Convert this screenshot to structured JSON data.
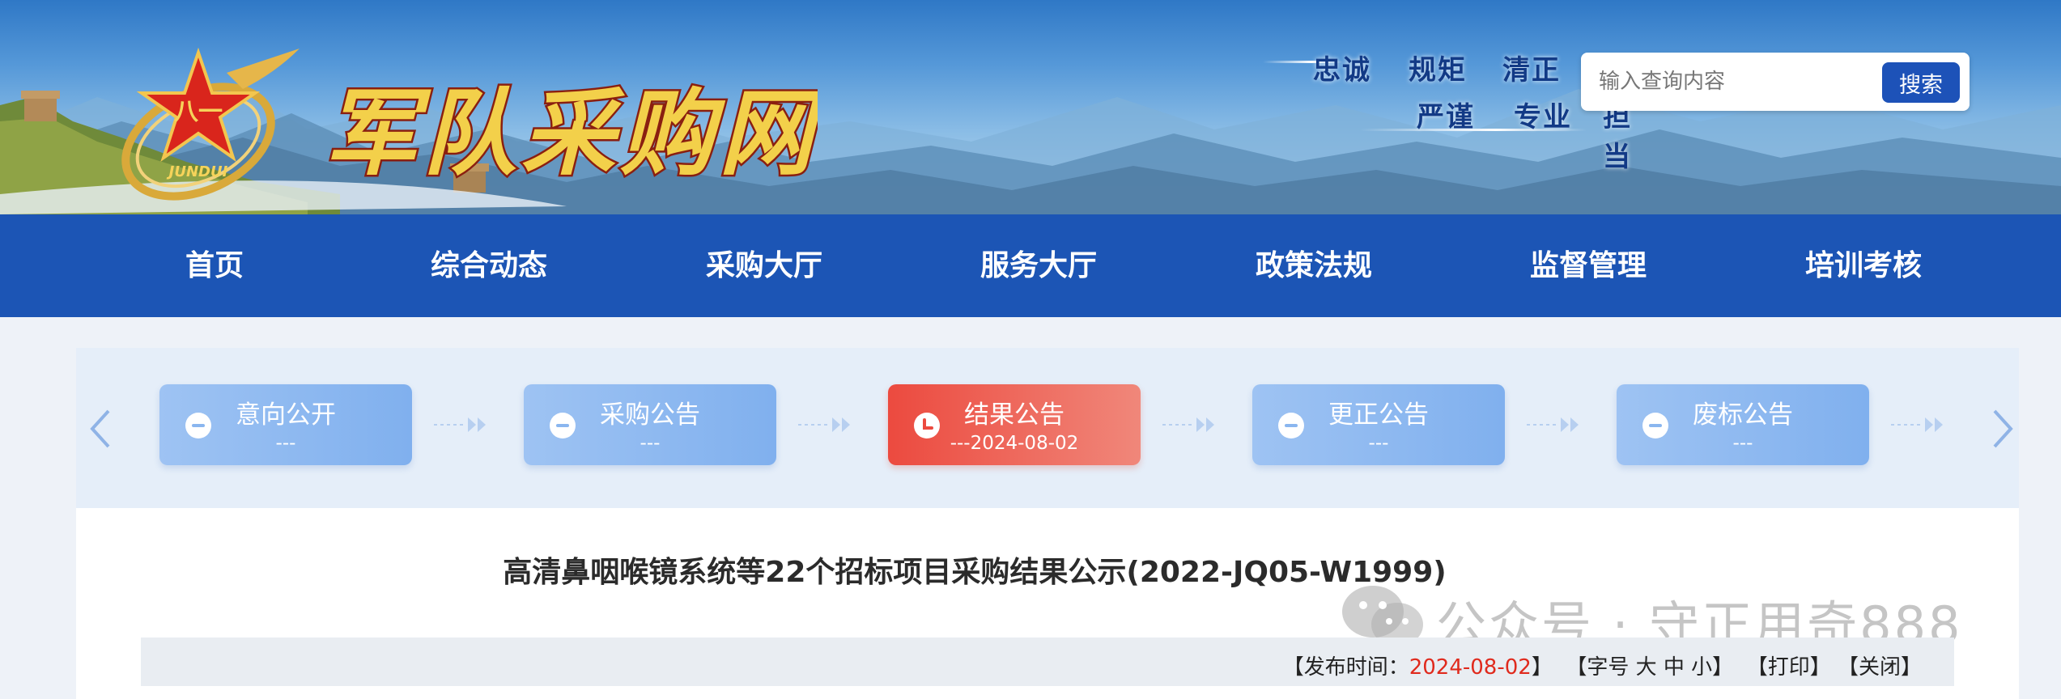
{
  "header": {
    "site_title": "军队采购网",
    "emblem_text": "JUNDUI",
    "slogans": [
      "忠诚",
      "规矩",
      "清正",
      "严谨",
      "专业",
      "担当"
    ]
  },
  "search": {
    "placeholder": "输入查询内容",
    "button_label": "搜索"
  },
  "nav": {
    "items": [
      "首页",
      "综合动态",
      "采购大厅",
      "服务大厅",
      "政策法规",
      "监督管理",
      "培训考核"
    ]
  },
  "process": {
    "steps": [
      {
        "title": "意向公开",
        "date": "---",
        "status": "pending"
      },
      {
        "title": "采购公告",
        "date": "---",
        "status": "pending"
      },
      {
        "title": "结果公告",
        "date": "---2024-08-02",
        "status": "active"
      },
      {
        "title": "更正公告",
        "date": "---",
        "status": "pending"
      },
      {
        "title": "废标公告",
        "date": "---",
        "status": "pending"
      }
    ]
  },
  "article": {
    "title": "高清鼻咽喉镜系统等22个招标项目采购结果公示(2022-JQ05-W1999)",
    "meta": {
      "publish_label": "【发布时间：",
      "publish_date": "2024-08-02",
      "publish_close": "】",
      "font_label": "【字号 大 中 小】",
      "print_label": "【打印】",
      "close_label": "【关闭】"
    }
  },
  "watermark": {
    "text": "公众号 · 守正用奇888"
  },
  "colors": {
    "nav_bg": "#1c55b5",
    "step_inactive": "#8ab6ef",
    "step_active": "#ec4a3f",
    "date_red": "#e02a1d"
  }
}
